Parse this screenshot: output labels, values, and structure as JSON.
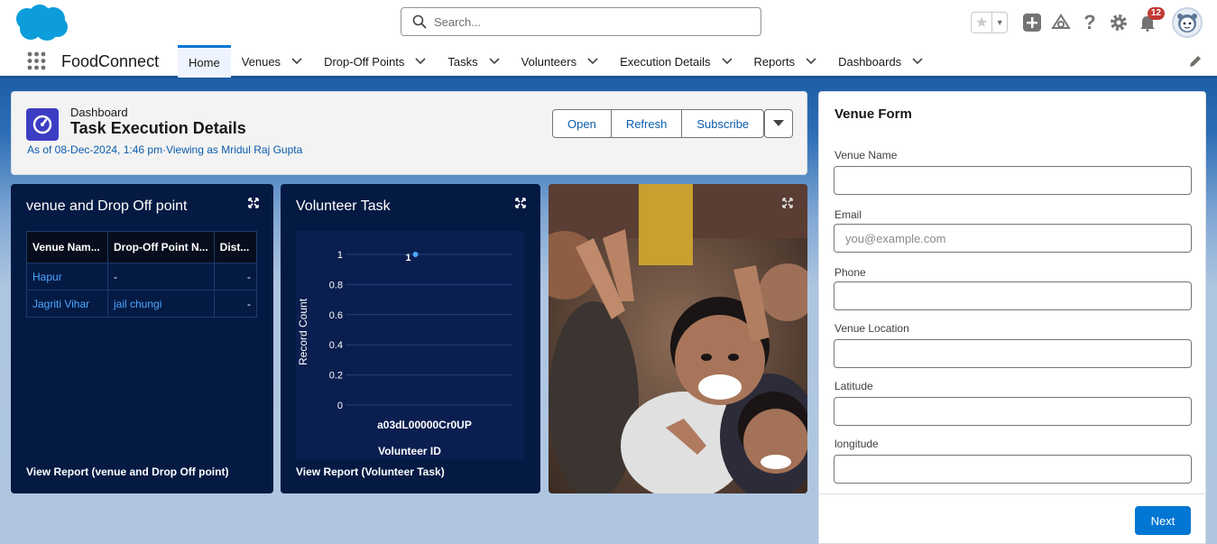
{
  "header": {
    "search_placeholder": "Search...",
    "notification_count": "12"
  },
  "nav": {
    "app_name": "FoodConnect",
    "tabs": [
      {
        "label": "Home"
      },
      {
        "label": "Venues"
      },
      {
        "label": "Drop-Off Points"
      },
      {
        "label": "Tasks"
      },
      {
        "label": "Volunteers"
      },
      {
        "label": "Execution Details"
      },
      {
        "label": "Reports"
      },
      {
        "label": "Dashboards"
      }
    ]
  },
  "dashboard": {
    "type_label": "Dashboard",
    "title": "Task Execution Details",
    "subtitle": "As of 08-Dec-2024, 1:46 pm·Viewing as Mridul Raj Gupta",
    "buttons": {
      "open": "Open",
      "refresh": "Refresh",
      "subscribe": "Subscribe"
    }
  },
  "widget_table": {
    "title": "venue and Drop Off point",
    "columns": [
      "Venue Nam...",
      "Drop-Off Point N...",
      "Dist..."
    ],
    "rows": [
      [
        "Hapur",
        "-",
        "-"
      ],
      [
        "Jagriti Vihar",
        "jail chungi",
        "-"
      ]
    ],
    "footer": "View Report (venue and Drop Off point)"
  },
  "widget_chart": {
    "title": "Volunteer Task",
    "footer": "View Report (Volunteer Task)"
  },
  "chart_data": {
    "type": "line",
    "categories": [
      "a03dL00000Cr0UP"
    ],
    "values": [
      1
    ],
    "data_labels": [
      "1"
    ],
    "xlabel": "Volunteer ID",
    "ylabel": "Record Count",
    "ylim": [
      0,
      1
    ],
    "yticks": [
      "0",
      "0.2",
      "0.4",
      "0.6",
      "0.8",
      "1"
    ],
    "grid": true,
    "color": "#4da6ff"
  },
  "venue_form": {
    "title": "Venue Form",
    "fields": [
      {
        "label": "Venue Name",
        "value": "",
        "placeholder": ""
      },
      {
        "label": "Email",
        "value": "",
        "placeholder": "you@example.com"
      },
      {
        "label": "Phone",
        "value": "",
        "placeholder": ""
      },
      {
        "label": "Venue Location",
        "value": "",
        "placeholder": ""
      },
      {
        "label": "Latitude",
        "value": "",
        "placeholder": ""
      },
      {
        "label": "longitude",
        "value": "",
        "placeholder": ""
      }
    ],
    "next_label": "Next"
  },
  "colors": {
    "brand": "#0176d3",
    "link": "#0b5cab",
    "widget_bg": "#041a43",
    "badge": "#c23934"
  }
}
